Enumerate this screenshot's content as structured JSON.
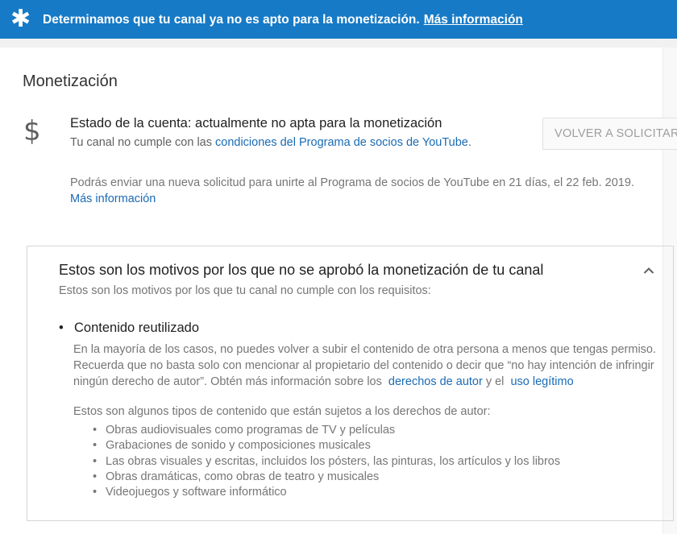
{
  "banner": {
    "icon": "asterisk-icon",
    "message": "Determinamos que tu canal ya no es apto para la monetización.",
    "link": "Más información",
    "color": "#167ac6"
  },
  "page": {
    "title": "Monetización"
  },
  "status": {
    "icon": "dollar-icon",
    "title": "Estado de la cuenta: actualmente no apta para la monetización",
    "sub_prefix": "Tu canal no cumple con las",
    "sub_link": "condiciones del Programa de socios de YouTube",
    "sub_suffix": ".",
    "button": "VOLVER A SOLICITAR"
  },
  "resubmit": {
    "text": "Podrás enviar una nueva solicitud para unirte al Programa de socios de YouTube en 21 días, el 22 feb. 2019.",
    "link": "Más información"
  },
  "reasons_panel": {
    "title": "Estos son los motivos por los que no se aprobó la monetización de tu canal",
    "subtitle": "Estos son los motivos por los que tu canal no cumple con los requisitos:",
    "toggle_icon": "chevron-up-icon",
    "reason": {
      "title": "Contenido reutilizado",
      "explain_1": "En la mayoría de los casos, no puedes volver a subir el contenido de otra persona a menos que tengas permiso. Recuerda que no basta solo con mencionar al propietario del contenido o decir que “no hay intención de infringir ningún derecho de autor”. Obtén más información sobre los",
      "link_1": "derechos de autor",
      "explain_2": "y el",
      "link_2": "uso legítimo",
      "types_intro": "Estos son algunos tipos de contenido que están sujetos a los derechos de autor:",
      "types": [
        "Obras audiovisuales como programas de TV y películas",
        "Grabaciones de sonido y composiciones musicales",
        "Las obras visuales y escritas, incluidos los pósters, las pinturas, los artículos y los libros",
        "Obras dramáticas, como obras de teatro y musicales",
        "Videojuegos y software informático"
      ]
    }
  }
}
